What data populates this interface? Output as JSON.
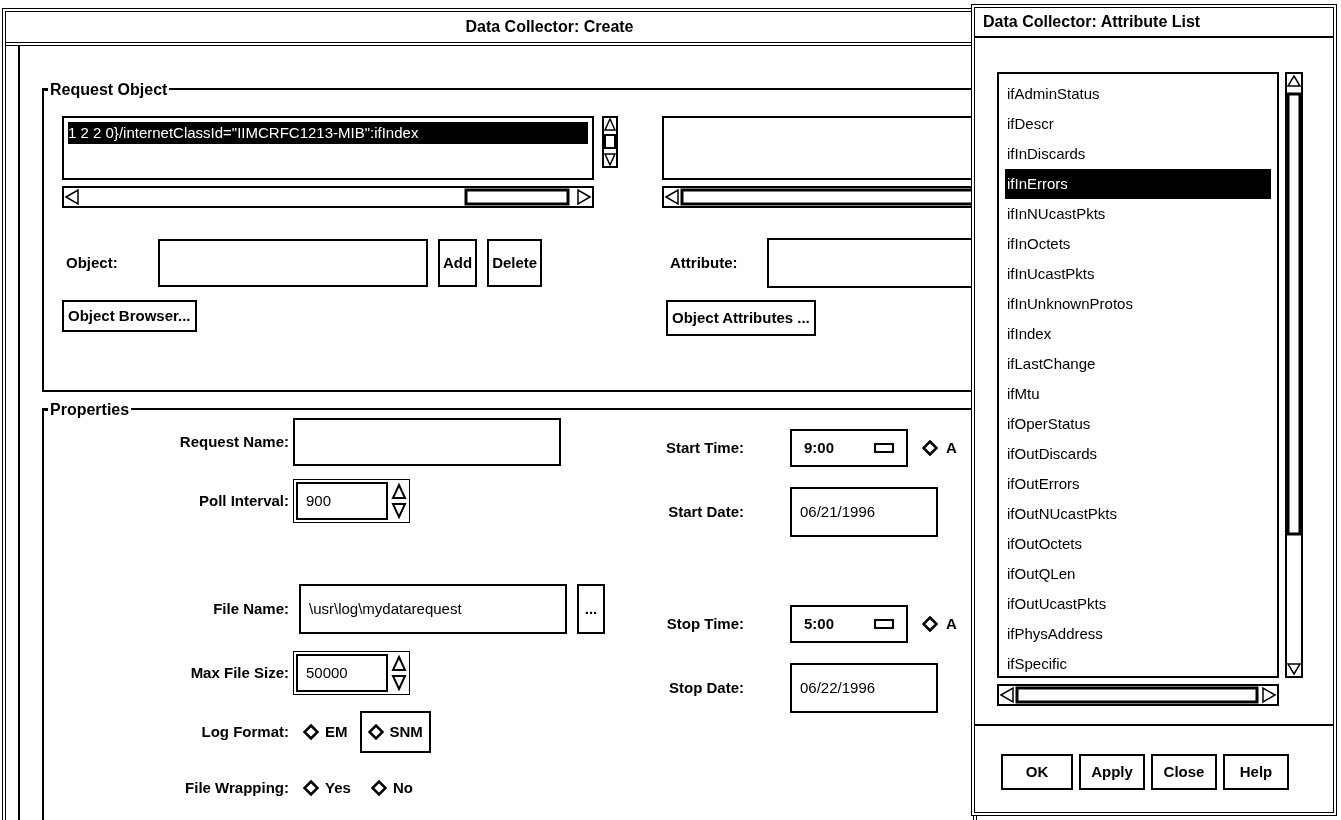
{
  "create_window": {
    "title": "Data Collector: Create",
    "request_object": {
      "legend": "Request Object",
      "object_list": [
        {
          "text": "1 2 2 0}/internetClassId=\"IIMCRFC1213-MIB\":ifIndex",
          "selected": true
        }
      ],
      "object_label": "Object:",
      "add_button": "Add",
      "delete_button": "Delete",
      "browser_button": "Object Browser...",
      "attribute_label": "Attribute:",
      "attributes_button": "Object Attributes ..."
    },
    "properties": {
      "legend": "Properties",
      "left": [
        {
          "kind": "text",
          "label": "Request Name:"
        },
        {
          "kind": "spin",
          "label": "Poll Interval:",
          "value": "900"
        },
        {
          "kind": "gap"
        },
        {
          "kind": "file",
          "label": "File Name:",
          "value": "\\usr\\log\\mydatarequest",
          "button": "..."
        },
        {
          "kind": "spin",
          "label": "Max File Size:",
          "value": "50000"
        },
        {
          "kind": "radio",
          "label": "Log Format:",
          "options": [
            {
              "label": "EM",
              "selected": false,
              "focused": false
            },
            {
              "label": "SNM",
              "selected": false,
              "focused": true
            }
          ]
        },
        {
          "kind": "radio",
          "label": "File Wrapping:",
          "options": [
            {
              "label": "Yes",
              "selected": false,
              "focused": false
            },
            {
              "label": "No",
              "selected": false,
              "focused": false
            }
          ]
        }
      ],
      "right": [
        {
          "kind": "time",
          "label": "Start Time:",
          "value": "9:00",
          "option": "A"
        },
        {
          "kind": "date",
          "label": "Start Date:",
          "value": "06/21/1996"
        },
        {
          "kind": "gap"
        },
        {
          "kind": "time",
          "label": "Stop Time:",
          "value": "5:00",
          "option": "A"
        },
        {
          "kind": "date",
          "label": "Stop Date:",
          "value": "06/22/1996"
        }
      ]
    }
  },
  "attribute_window": {
    "title": "Data Collector: Attribute List",
    "items": [
      {
        "label": "ifAdminStatus",
        "selected": false
      },
      {
        "label": "ifDescr",
        "selected": false
      },
      {
        "label": "ifInDiscards",
        "selected": false
      },
      {
        "label": "ifInErrors",
        "selected": true
      },
      {
        "label": "ifInNUcastPkts",
        "selected": false
      },
      {
        "label": "ifInOctets",
        "selected": false
      },
      {
        "label": "ifInUcastPkts",
        "selected": false
      },
      {
        "label": "ifInUnknownProtos",
        "selected": false
      },
      {
        "label": "ifIndex",
        "selected": false
      },
      {
        "label": "ifLastChange",
        "selected": false
      },
      {
        "label": "ifMtu",
        "selected": false
      },
      {
        "label": "ifOperStatus",
        "selected": false
      },
      {
        "label": "ifOutDiscards",
        "selected": false
      },
      {
        "label": "ifOutErrors",
        "selected": false
      },
      {
        "label": "ifOutNUcastPkts",
        "selected": false
      },
      {
        "label": "ifOutOctets",
        "selected": false
      },
      {
        "label": "ifOutQLen",
        "selected": false
      },
      {
        "label": "ifOutUcastPkts",
        "selected": false
      },
      {
        "label": "ifPhysAddress",
        "selected": false
      },
      {
        "label": "ifSpecific",
        "selected": false
      }
    ],
    "buttons": [
      "OK",
      "Apply",
      "Close",
      "Help"
    ]
  }
}
